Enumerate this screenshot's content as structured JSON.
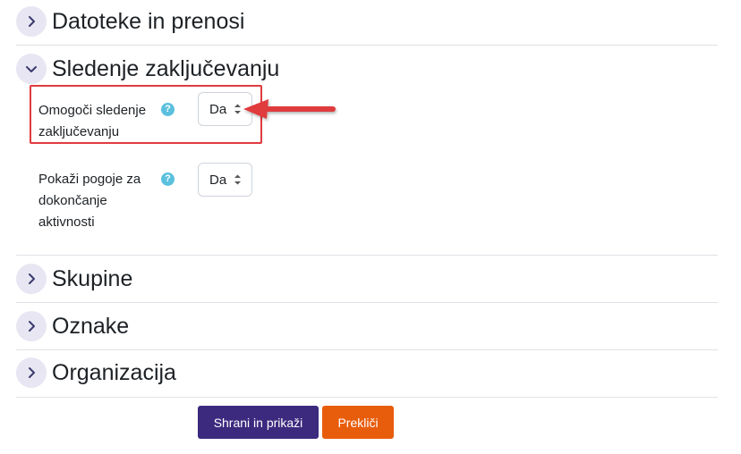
{
  "sections": {
    "files": {
      "title": "Datoteke in prenosi",
      "expanded": false
    },
    "completion": {
      "title": "Sledenje zaključevanju",
      "expanded": true
    },
    "groups": {
      "title": "Skupine",
      "expanded": false
    },
    "tags": {
      "title": "Oznake",
      "expanded": false
    },
    "organization": {
      "title": "Organizacija",
      "expanded": false
    }
  },
  "completion_fields": {
    "enable_tracking": {
      "label_line1": "Omogoči sledenje",
      "label_line2": "zaključevanju",
      "value": "Da",
      "help": "?"
    },
    "show_conditions": {
      "label_line1": "Pokaži pogoje za",
      "label_line2": "dokončanje",
      "label_line3": "aktivnosti",
      "value": "Da",
      "help": "?"
    }
  },
  "buttons": {
    "save_display": "Shrani in prikaži",
    "cancel": "Prekliči"
  },
  "colors": {
    "primary_button": "#3b2a7e",
    "cancel_button": "#e85d0c",
    "annotation_red": "#e03a3e",
    "help_icon": "#5bc0de",
    "chevron_bg": "#e7e6f2"
  }
}
